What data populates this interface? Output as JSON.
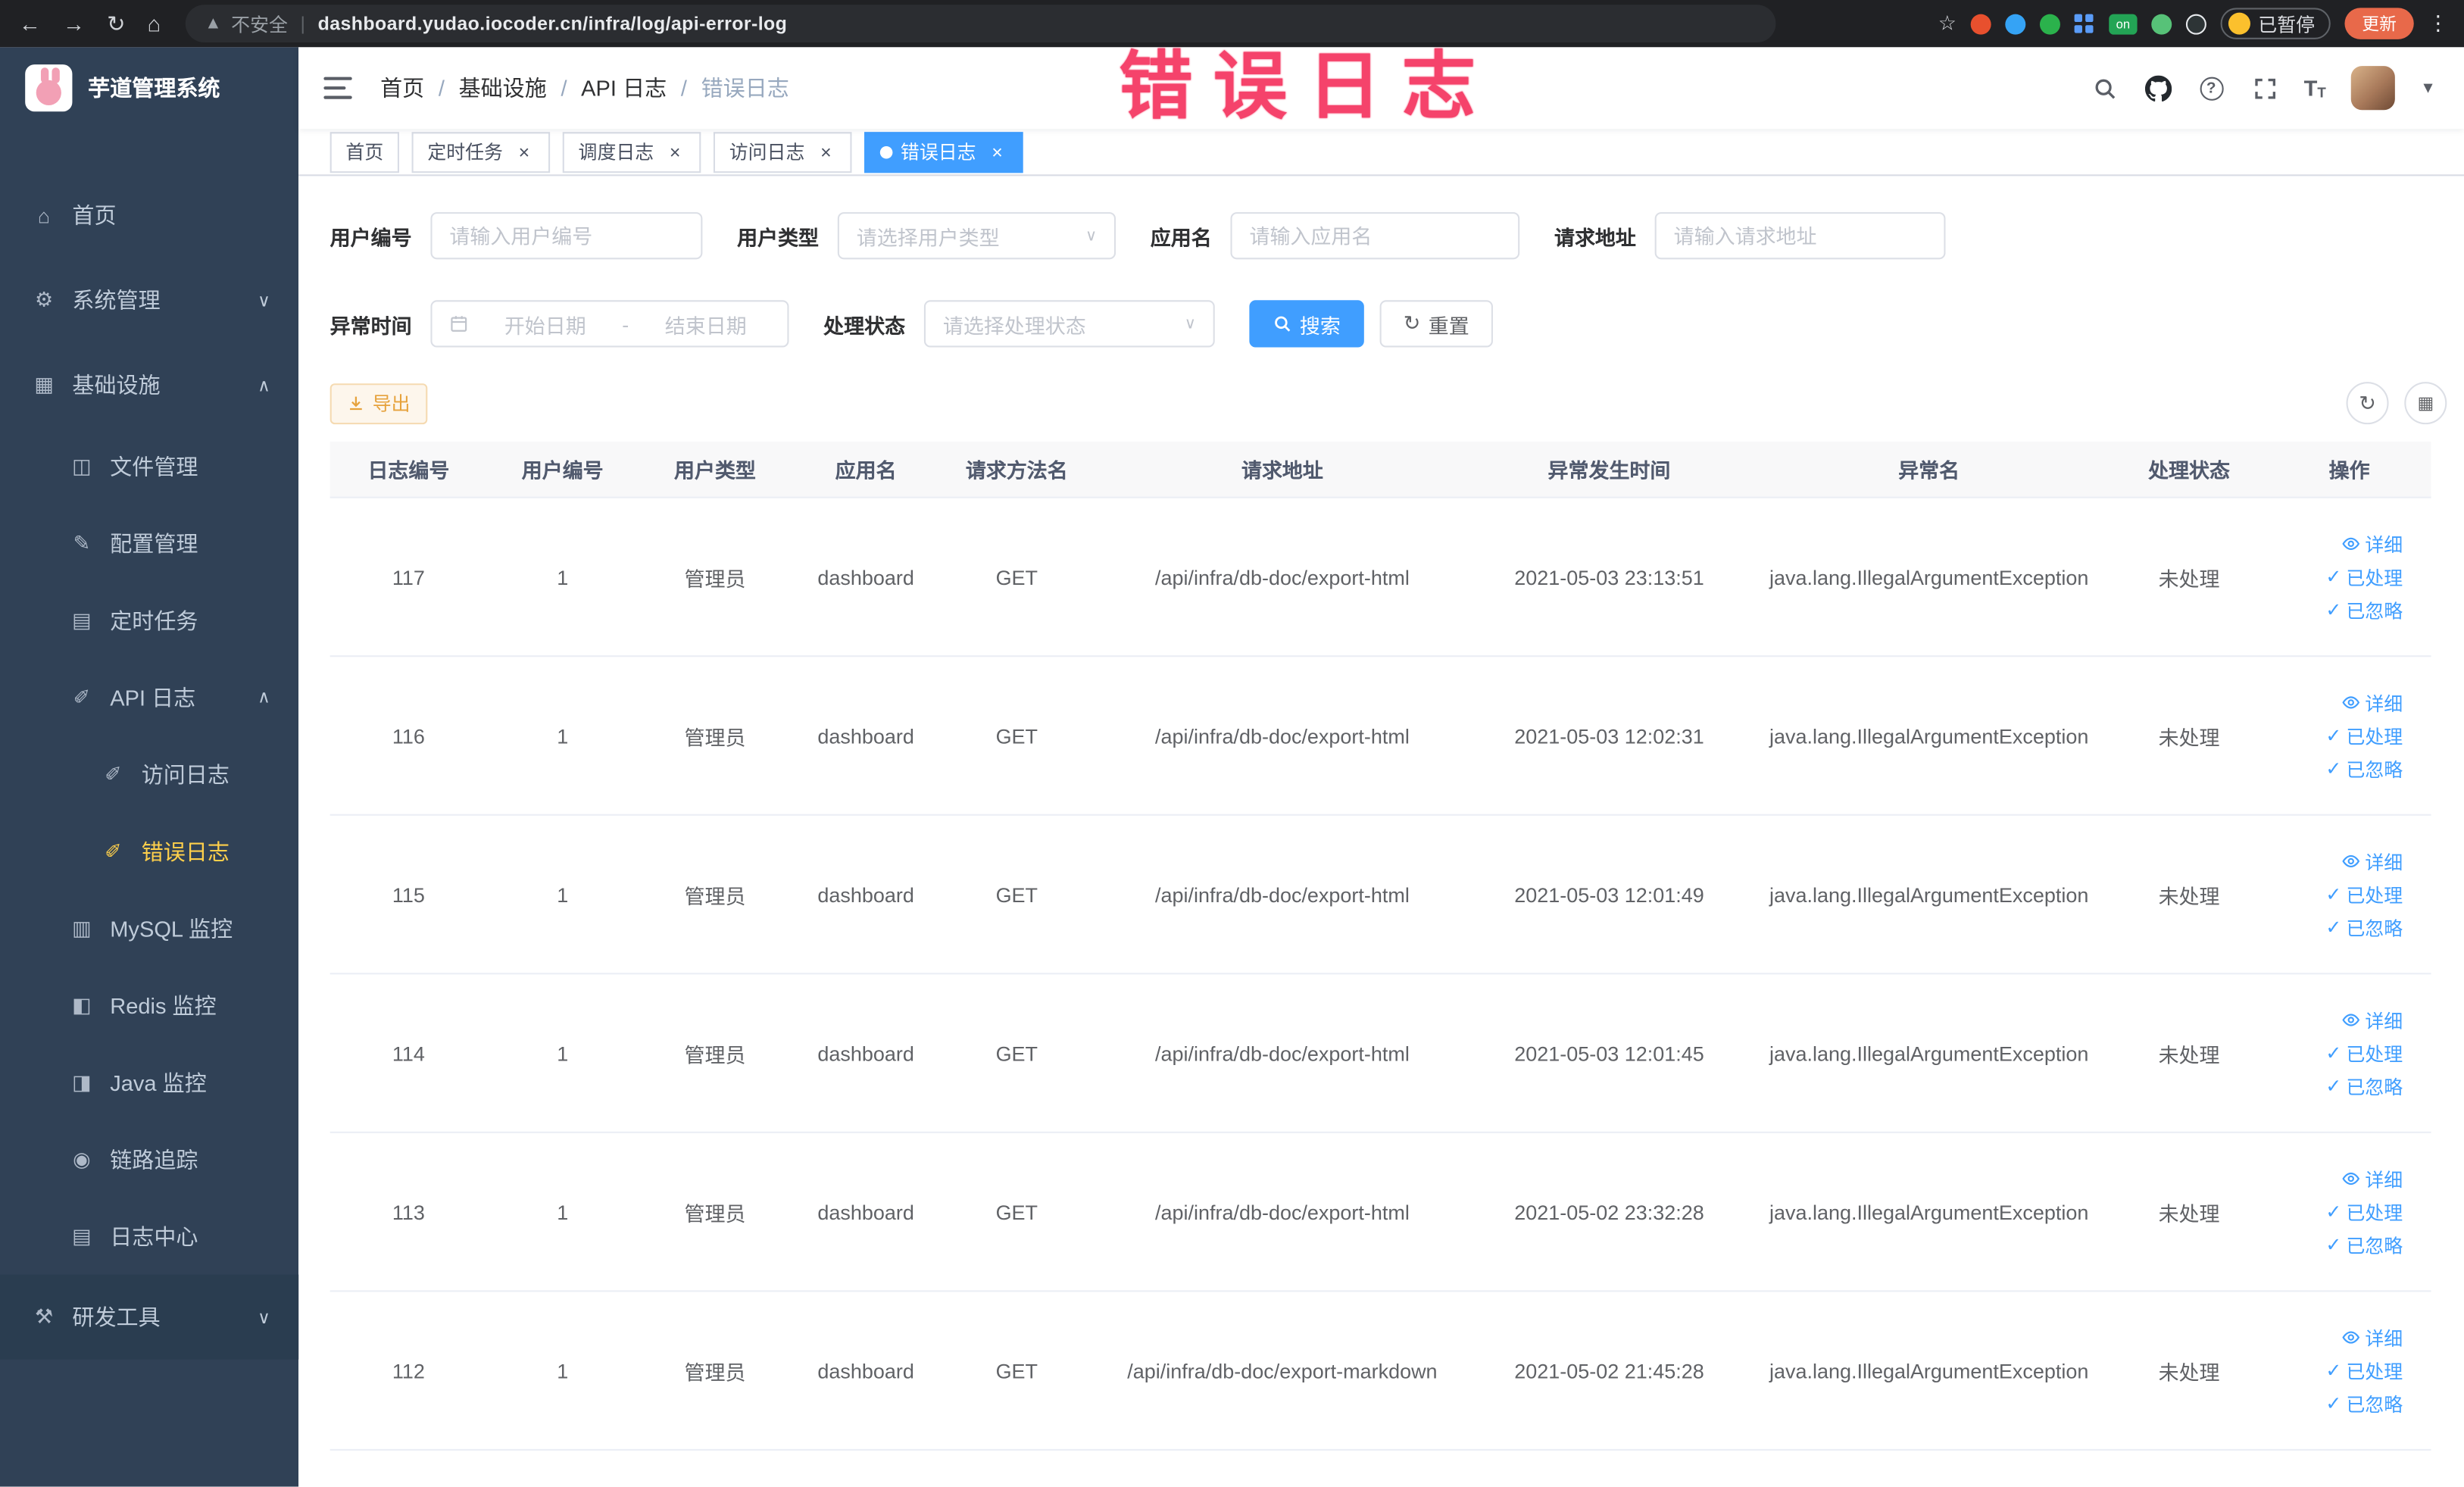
{
  "browser": {
    "security_label": "不安全",
    "separator": "|",
    "url": "dashboard.yudao.iocoder.cn/infra/log/api-error-log",
    "ext_on_label": "on",
    "profile_badge": "已暂停",
    "update_label": "更新"
  },
  "sidebar": {
    "title": "芋道管理系统",
    "items": [
      {
        "label": "首页"
      },
      {
        "label": "系统管理"
      },
      {
        "label": "基础设施"
      },
      {
        "label": "文件管理"
      },
      {
        "label": "配置管理"
      },
      {
        "label": "定时任务"
      },
      {
        "label": "API 日志"
      },
      {
        "label": "访问日志"
      },
      {
        "label": "错误日志"
      },
      {
        "label": "MySQL 监控"
      },
      {
        "label": "Redis 监控"
      },
      {
        "label": "Java 监控"
      },
      {
        "label": "链路追踪"
      },
      {
        "label": "日志中心"
      },
      {
        "label": "研发工具"
      }
    ]
  },
  "header": {
    "breadcrumbs": [
      "首页",
      "基础设施",
      "API 日志",
      "错误日志"
    ],
    "breadcrumb_separator": "/",
    "annotation": "错误日志"
  },
  "tabs": [
    {
      "label": "首页"
    },
    {
      "label": "定时任务"
    },
    {
      "label": "调度日志"
    },
    {
      "label": "访问日志"
    },
    {
      "label": "错误日志"
    }
  ],
  "filters": {
    "user_id_label": "用户编号",
    "user_id_placeholder": "请输入用户编号",
    "user_type_label": "用户类型",
    "user_type_placeholder": "请选择用户类型",
    "app_name_label": "应用名",
    "app_name_placeholder": "请输入应用名",
    "request_url_label": "请求地址",
    "request_url_placeholder": "请输入请求地址",
    "exception_time_label": "异常时间",
    "start_date_placeholder": "开始日期",
    "range_separator": "-",
    "end_date_placeholder": "结束日期",
    "process_status_label": "处理状态",
    "process_status_placeholder": "请选择处理状态",
    "search_button": "搜索",
    "reset_button": "重置"
  },
  "toolbar": {
    "export_button": "导出"
  },
  "table": {
    "headers": [
      "日志编号",
      "用户编号",
      "用户类型",
      "应用名",
      "请求方法名",
      "请求地址",
      "异常发生时间",
      "异常名",
      "处理状态",
      "操作"
    ],
    "actions": {
      "detail": "详细",
      "processed": "已处理",
      "ignored": "已忽略"
    },
    "rows": [
      {
        "id": "117",
        "user_id": "1",
        "user_type": "管理员",
        "app": "dashboard",
        "method": "GET",
        "url": "/api/infra/db-doc/export-html",
        "time": "2021-05-03 23:13:51",
        "exception": "java.lang.IllegalArgumentException",
        "status": "未处理"
      },
      {
        "id": "116",
        "user_id": "1",
        "user_type": "管理员",
        "app": "dashboard",
        "method": "GET",
        "url": "/api/infra/db-doc/export-html",
        "time": "2021-05-03 12:02:31",
        "exception": "java.lang.IllegalArgumentException",
        "status": "未处理"
      },
      {
        "id": "115",
        "user_id": "1",
        "user_type": "管理员",
        "app": "dashboard",
        "method": "GET",
        "url": "/api/infra/db-doc/export-html",
        "time": "2021-05-03 12:01:49",
        "exception": "java.lang.IllegalArgumentException",
        "status": "未处理"
      },
      {
        "id": "114",
        "user_id": "1",
        "user_type": "管理员",
        "app": "dashboard",
        "method": "GET",
        "url": "/api/infra/db-doc/export-html",
        "time": "2021-05-03 12:01:45",
        "exception": "java.lang.IllegalArgumentException",
        "status": "未处理"
      },
      {
        "id": "113",
        "user_id": "1",
        "user_type": "管理员",
        "app": "dashboard",
        "method": "GET",
        "url": "/api/infra/db-doc/export-html",
        "time": "2021-05-02 23:32:28",
        "exception": "java.lang.IllegalArgumentException",
        "status": "未处理"
      },
      {
        "id": "112",
        "user_id": "1",
        "user_type": "管理员",
        "app": "dashboard",
        "method": "GET",
        "url": "/api/infra/db-doc/export-markdown",
        "time": "2021-05-02 21:45:28",
        "exception": "java.lang.IllegalArgumentException",
        "status": "未处理"
      }
    ]
  },
  "colors": {
    "primary": "#409eff",
    "menu_active": "#ffd04b",
    "annotation": "#f5436b",
    "warning": "#e6a23c",
    "sidebar_bg": "#304156"
  }
}
